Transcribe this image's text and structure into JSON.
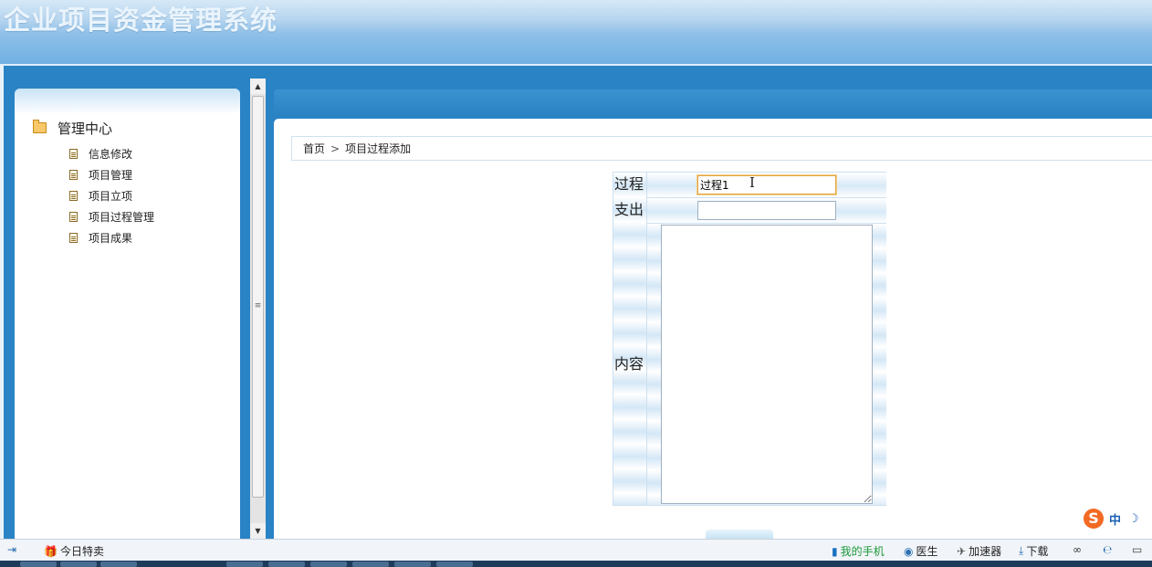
{
  "app": {
    "title": "企业项目资金管理系统"
  },
  "sidebar": {
    "heading": "管理中心",
    "items": [
      {
        "label": "信息修改"
      },
      {
        "label": "项目管理"
      },
      {
        "label": "项目立项"
      },
      {
        "label": "项目过程管理"
      },
      {
        "label": "项目成果"
      }
    ]
  },
  "breadcrumb": {
    "home": "首页",
    "separator": ">",
    "current": "项目过程添加"
  },
  "form": {
    "process_label": "过程",
    "process_value": "过程1",
    "expense_label": "支出",
    "expense_value": "",
    "content_label": "内容",
    "content_value": ""
  },
  "ime": {
    "logo": "S",
    "mode": "中",
    "moon": "☽"
  },
  "statusbar": {
    "deal": "今日特卖",
    "phone": "我的手机",
    "doctor": "医生",
    "accelerator": "加速器",
    "download": "下载"
  },
  "colors": {
    "accent": "#2a83c5",
    "focus": "#e2a23a",
    "ime": "#f26a23"
  }
}
